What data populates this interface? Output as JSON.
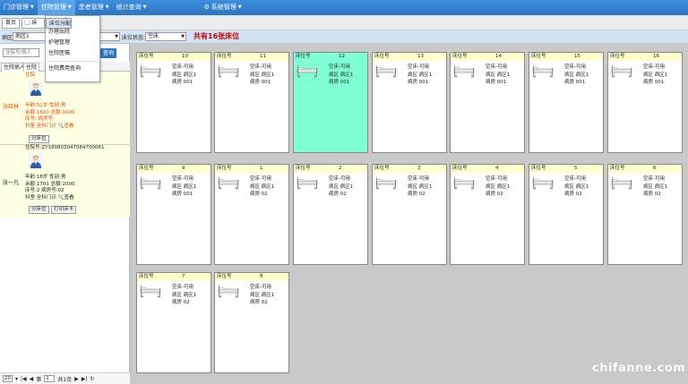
{
  "menubar": {
    "items": [
      {
        "label": "门诊管理"
      },
      {
        "label": "住院管理"
      },
      {
        "label": "患者管理"
      },
      {
        "label": "统计查询"
      },
      {
        "label": "系统管理"
      }
    ]
  },
  "dropdown": {
    "items": [
      {
        "label": "办理入院"
      },
      {
        "label": "办理出院"
      },
      {
        "label": "床位分配"
      },
      {
        "label": "护理管理"
      },
      {
        "label": "住院医嘱"
      },
      {
        "label": "住院费用查询"
      }
    ]
  },
  "toolbar": {
    "home_tab": "首页",
    "second_tab": "床"
  },
  "filters": {
    "ward_label": "病区:",
    "ward_value": "病区1",
    "bed_status_label": "床位状态:",
    "bed_status_value": "空床",
    "total_text": "共有16张床位"
  },
  "left": {
    "search_placeholder": "住院号/病人",
    "search_button": "查询",
    "tabs": [
      "住院病人",
      "住院"
    ],
    "patients": [
      {
        "name": "张晓林",
        "id_line": "住院",
        "line1": "年龄:52岁 性别:男",
        "line2": "余额:1600 总额:1600",
        "line3": "床号: 病房号:",
        "line4": "科室:全科门诊",
        "view": "查看",
        "btn1": "分床位"
      },
      {
        "name": "张一凡",
        "id_line": "住院号:ZY180803047084700061",
        "line1": "年龄:18岁 性别:男",
        "line2": "余额:1701 总额:2000",
        "line3": "床号:2 病房号:02",
        "line4": "科室:全科门诊",
        "view": "查看",
        "btn1": "分床位",
        "btn2": "打印床卡"
      }
    ],
    "pager": {
      "page_size": "20",
      "page_label": "第",
      "page_value": "1",
      "total_pages": "共1页"
    }
  },
  "beds": {
    "header_label": "床位号",
    "items": [
      {
        "no": "10",
        "status": "空床-可用",
        "ward": "病区 病区1",
        "room": "病房 001",
        "occupied": false
      },
      {
        "no": "11",
        "status": "空床-可用",
        "ward": "病区 病区1",
        "room": "病房 001",
        "occupied": false
      },
      {
        "no": "12",
        "status": "空床-可用",
        "ward": "病区 病区1",
        "room": "病房 001",
        "occupied": true
      },
      {
        "no": "13",
        "status": "空床-可用",
        "ward": "病区 病区1",
        "room": "病房 001",
        "occupied": false
      },
      {
        "no": "14",
        "status": "空床-可用",
        "ward": "病区 病区1",
        "room": "病房 001",
        "occupied": false
      },
      {
        "no": "15",
        "status": "空床-可用",
        "ward": "病区 病区1",
        "room": "病房 001",
        "occupied": false
      },
      {
        "no": "16",
        "status": "空床-可用",
        "ward": "病区 病区1",
        "room": "病房 001",
        "occupied": false
      },
      {
        "no": "9",
        "status": "空床-可用",
        "ward": "病区 病区1",
        "room": "病房 001",
        "occupied": false
      },
      {
        "no": "1",
        "status": "空床-可用",
        "ward": "病区 病区1",
        "room": "病房 02",
        "occupied": false
      },
      {
        "no": "2",
        "status": "空床-可用",
        "ward": "病区 病区1",
        "room": "病房 02",
        "occupied": false
      },
      {
        "no": "3",
        "status": "空床-可用",
        "ward": "病区 病区1",
        "room": "病房 02",
        "occupied": false
      },
      {
        "no": "4",
        "status": "空床-可用",
        "ward": "病区 病区1",
        "room": "病房 02",
        "occupied": false
      },
      {
        "no": "5",
        "status": "空床-可用",
        "ward": "病区 病区1",
        "room": "病房 02",
        "occupied": false
      },
      {
        "no": "6",
        "status": "空床-可用",
        "ward": "病区 病区1",
        "room": "病房 02",
        "occupied": false
      },
      {
        "no": "7",
        "status": "空床-可用",
        "ward": "病区 病区1",
        "room": "病房 02",
        "occupied": false
      },
      {
        "no": "8",
        "status": "空床-可用",
        "ward": "病区 病区1",
        "room": "病房 02",
        "occupied": false
      }
    ]
  },
  "watermark": "chifanne.com",
  "colors": {
    "menubar": "#2a74c4",
    "card_header": "#ffffcc",
    "occupied": "#7fffd4",
    "total_text": "#c00000"
  }
}
